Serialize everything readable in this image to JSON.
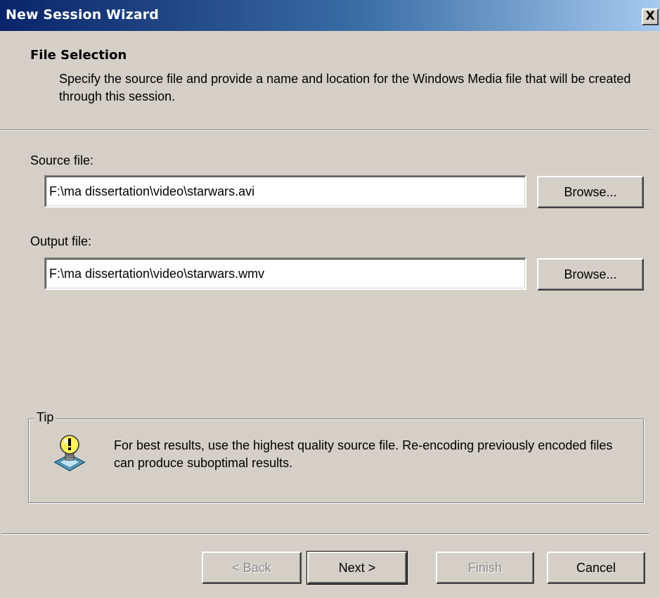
{
  "window": {
    "title": "New Session Wizard",
    "close_glyph": "X"
  },
  "header": {
    "title": "File Selection",
    "description": "Specify the source file and provide a name and location for the Windows Media file that will be created through this session."
  },
  "source": {
    "label": "Source file:",
    "value": "F:\\ma dissertation\\video\\starwars.avi",
    "browse_label": "Browse..."
  },
  "output": {
    "label": "Output file:",
    "value": "F:\\ma dissertation\\video\\starwars.wmv",
    "browse_label": "Browse..."
  },
  "tip": {
    "legend": "Tip",
    "icon": "lightbulb-icon",
    "text": "For best results, use the highest quality source file. Re-encoding previously encoded files can produce suboptimal results."
  },
  "buttons": {
    "back": "< Back",
    "next": "Next >",
    "finish": "Finish",
    "cancel": "Cancel"
  },
  "colors": {
    "face": "#d4d0c8",
    "titlebar_start": "#0a246a",
    "titlebar_end": "#a6caf0",
    "disabled_text": "#8a8a8a"
  }
}
